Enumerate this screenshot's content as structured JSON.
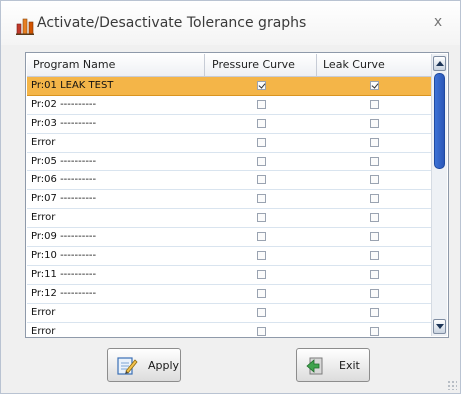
{
  "window": {
    "title": "Activate/Desactivate Tolerance graphs",
    "close_label": "x"
  },
  "table": {
    "columns": [
      "Program Name",
      "Pressure Curve",
      "Leak Curve"
    ],
    "rows": [
      {
        "name": "Pr:01  LEAK TEST",
        "pressure": true,
        "leak": true,
        "selected": true
      },
      {
        "name": "Pr:02  ----------",
        "pressure": false,
        "leak": false,
        "selected": false
      },
      {
        "name": "Pr:03  ----------",
        "pressure": false,
        "leak": false,
        "selected": false
      },
      {
        "name": "Error",
        "pressure": false,
        "leak": false,
        "selected": false
      },
      {
        "name": "Pr:05  ----------",
        "pressure": false,
        "leak": false,
        "selected": false
      },
      {
        "name": "Pr:06  ----------",
        "pressure": false,
        "leak": false,
        "selected": false
      },
      {
        "name": "Pr:07  ----------",
        "pressure": false,
        "leak": false,
        "selected": false
      },
      {
        "name": "Error",
        "pressure": false,
        "leak": false,
        "selected": false
      },
      {
        "name": "Pr:09  ----------",
        "pressure": false,
        "leak": false,
        "selected": false
      },
      {
        "name": "Pr:10  ----------",
        "pressure": false,
        "leak": false,
        "selected": false
      },
      {
        "name": "Pr:11  ----------",
        "pressure": false,
        "leak": false,
        "selected": false
      },
      {
        "name": "Pr:12  ----------",
        "pressure": false,
        "leak": false,
        "selected": false
      },
      {
        "name": "Error",
        "pressure": false,
        "leak": false,
        "selected": false
      },
      {
        "name": "Error",
        "pressure": false,
        "leak": false,
        "selected": false
      }
    ],
    "selection_color": "#f4b548"
  },
  "buttons": {
    "apply_label": "Apply",
    "apply_icon": "edit-document-icon",
    "exit_label": "Exit",
    "exit_icon": "exit-door-icon"
  },
  "icons": {
    "app_icon": "bar-chart-icon"
  }
}
